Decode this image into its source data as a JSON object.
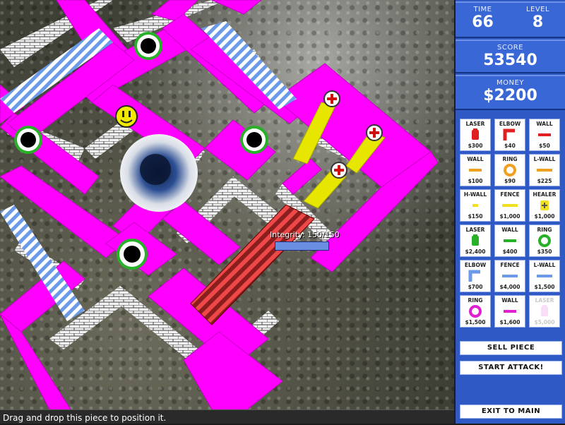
{
  "hud": {
    "time_label": "TIME",
    "time_value": "66",
    "level_label": "LEVEL",
    "level_value": "8",
    "score_label": "SCORE",
    "score_value": "53540",
    "money_label": "MONEY",
    "money_value": "$2200"
  },
  "integrity": {
    "label": "Integrity: 150/150",
    "fraction": 1.0
  },
  "status_text": "Drag and drop this piece to position it.",
  "shop": [
    {
      "name": "LASER",
      "price": "$300",
      "color": "#e02020",
      "icon": "laser-icon",
      "enabled": true
    },
    {
      "name": "ELBOW",
      "price": "$40",
      "color": "#e02020",
      "icon": "elbow-icon",
      "enabled": true
    },
    {
      "name": "WALL",
      "price": "$50",
      "color": "#e02020",
      "icon": "wall-icon",
      "enabled": true
    },
    {
      "name": "WALL",
      "price": "$100",
      "color": "#f0a020",
      "icon": "wall-icon",
      "enabled": true
    },
    {
      "name": "RING",
      "price": "$90",
      "color": "#f0a020",
      "icon": "ring-icon",
      "enabled": true
    },
    {
      "name": "L-WALL",
      "price": "$225",
      "color": "#f0a020",
      "icon": "long-wall-icon",
      "enabled": true
    },
    {
      "name": "H-WALL",
      "price": "$150",
      "color": "#f0e020",
      "icon": "half-wall-icon",
      "enabled": true
    },
    {
      "name": "FENCE",
      "price": "$1,000",
      "color": "#f0e020",
      "icon": "fence-icon",
      "enabled": true
    },
    {
      "name": "HEALER",
      "price": "$1,000",
      "color": "#f0e020",
      "icon": "healer-icon",
      "enabled": true
    },
    {
      "name": "LASER",
      "price": "$2,400",
      "color": "#28b028",
      "icon": "laser-icon",
      "enabled": true
    },
    {
      "name": "WALL",
      "price": "$400",
      "color": "#28b028",
      "icon": "wall-icon",
      "enabled": true
    },
    {
      "name": "RING",
      "price": "$350",
      "color": "#28b028",
      "icon": "ring-icon",
      "enabled": true
    },
    {
      "name": "ELBOW",
      "price": "$700",
      "color": "#6a9ae8",
      "icon": "elbow-icon",
      "enabled": true
    },
    {
      "name": "FENCE",
      "price": "$4,000",
      "color": "#6a9ae8",
      "icon": "fence-icon",
      "enabled": true
    },
    {
      "name": "L-WALL",
      "price": "$1,500",
      "color": "#6a9ae8",
      "icon": "long-wall-icon",
      "enabled": true
    },
    {
      "name": "RING",
      "price": "$1,500",
      "color": "#e020d0",
      "icon": "ring-icon",
      "enabled": true
    },
    {
      "name": "WALL",
      "price": "$1,600",
      "color": "#e020d0",
      "icon": "wall-icon",
      "enabled": true
    },
    {
      "name": "LASER",
      "price": "$5,000",
      "color": "#f2a0e8",
      "icon": "laser-icon",
      "enabled": false
    }
  ],
  "buttons": {
    "sell": "SELL PIECE",
    "attack": "START ATTACK!",
    "exit": "EXIT TO MAIN"
  },
  "colors": {
    "track": "#ff00ff",
    "panel": "#2f59c4",
    "fence_blue": "#6a9ae8",
    "ghost_piece": "#e03a3a"
  }
}
